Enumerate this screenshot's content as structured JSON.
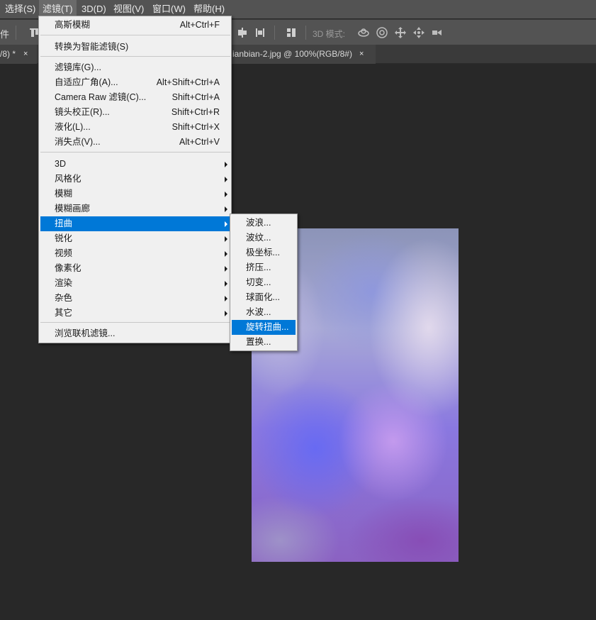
{
  "menubar": {
    "items": [
      {
        "label": "选择(S)"
      },
      {
        "label": "滤镜(T)"
      },
      {
        "label": "3D(D)"
      },
      {
        "label": "视图(V)"
      },
      {
        "label": "窗口(W)"
      },
      {
        "label": "帮助(H)"
      }
    ],
    "active_item": "滤镜(T)"
  },
  "options_bar": {
    "left_label": "件",
    "mode_label": "3D 模式:",
    "icons": [
      "align-top-icon",
      "distribute-vertical-icon",
      "distribute-horizontal-icon",
      "auto-align-icon",
      "orbit-3d-icon",
      "roll-3d-icon",
      "pan-3d-icon",
      "slide-3d-icon",
      "scale-3d-icon"
    ]
  },
  "tabs": [
    {
      "label": "/8) *",
      "close": "×"
    },
    {
      "label": "ianbian-2.jpg @ 100%(RGB/8#)",
      "close": "×"
    }
  ],
  "filter_menu": {
    "items": [
      {
        "label": "高斯模糊",
        "shortcut": "Alt+Ctrl+F"
      },
      {
        "label": "转换为智能滤镜(S)",
        "shortcut": ""
      },
      {
        "label": "滤镜库(G)...",
        "shortcut": ""
      },
      {
        "label": "自适应广角(A)...",
        "shortcut": "Alt+Shift+Ctrl+A"
      },
      {
        "label": "Camera Raw 滤镜(C)...",
        "shortcut": "Shift+Ctrl+A"
      },
      {
        "label": "镜头校正(R)...",
        "shortcut": "Shift+Ctrl+R"
      },
      {
        "label": "液化(L)...",
        "shortcut": "Shift+Ctrl+X"
      },
      {
        "label": "消失点(V)...",
        "shortcut": "Alt+Ctrl+V"
      },
      {
        "label": "3D",
        "submenu": true
      },
      {
        "label": "风格化",
        "submenu": true
      },
      {
        "label": "模糊",
        "submenu": true
      },
      {
        "label": "模糊画廊",
        "submenu": true
      },
      {
        "label": "扭曲",
        "submenu": true,
        "highlighted": true
      },
      {
        "label": "锐化",
        "submenu": true
      },
      {
        "label": "视频",
        "submenu": true
      },
      {
        "label": "像素化",
        "submenu": true
      },
      {
        "label": "渲染",
        "submenu": true
      },
      {
        "label": "杂色",
        "submenu": true
      },
      {
        "label": "其它",
        "submenu": true
      },
      {
        "label": "浏览联机滤镜...",
        "shortcut": ""
      }
    ]
  },
  "distort_submenu": {
    "items": [
      {
        "label": "波浪..."
      },
      {
        "label": "波纹..."
      },
      {
        "label": "极坐标..."
      },
      {
        "label": "挤压..."
      },
      {
        "label": "切变..."
      },
      {
        "label": "球面化..."
      },
      {
        "label": "水波..."
      },
      {
        "label": "旋转扭曲...",
        "highlighted": true
      },
      {
        "label": "置换..."
      }
    ]
  },
  "colors": {
    "highlight": "#0078d7",
    "menu_bg": "#f0f0f0",
    "chrome": "#535353",
    "workspace": "#282828"
  }
}
